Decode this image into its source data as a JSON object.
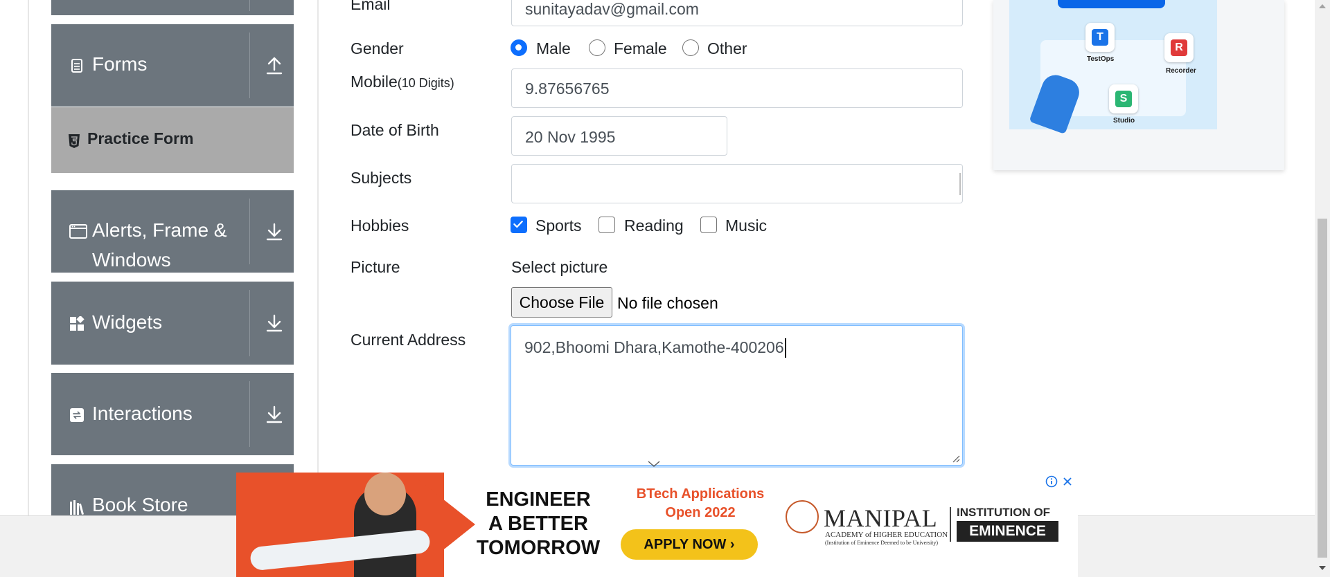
{
  "sidebar": {
    "groups": [
      {
        "label": "Forms",
        "icon": "form-icon",
        "arrow": "upload-arrow-icon"
      },
      {
        "label_lines": [
          "Alerts, Frame &",
          "Windows"
        ],
        "icon": "browser-window-icon",
        "arrow": "download-arrow-icon"
      },
      {
        "label": "Widgets",
        "icon": "widgets-icon",
        "arrow": "download-arrow-icon"
      },
      {
        "label": "Interactions",
        "icon": "interactions-icon",
        "arrow": "download-arrow-icon"
      },
      {
        "label": "Book Store",
        "icon": "books-icon"
      }
    ],
    "active_item": {
      "label": "Practice Form",
      "icon": "html5-icon"
    }
  },
  "form": {
    "email": {
      "label": "Email",
      "value": "sunitayadav@gmail.com"
    },
    "gender": {
      "label": "Gender",
      "options": [
        "Male",
        "Female",
        "Other"
      ],
      "selected": "Male"
    },
    "mobile": {
      "label": "Mobile",
      "label_hint": "(10 Digits)",
      "value": "9.87656765"
    },
    "dob": {
      "label": "Date of Birth",
      "value": "20 Nov 1995"
    },
    "subjects": {
      "label": "Subjects",
      "value": ""
    },
    "hobbies": {
      "label": "Hobbies",
      "options": [
        {
          "label": "Sports",
          "checked": true
        },
        {
          "label": "Reading",
          "checked": false
        },
        {
          "label": "Music",
          "checked": false
        }
      ]
    },
    "picture": {
      "label": "Picture",
      "prompt": "Select picture",
      "button": "Choose File",
      "status": "No file chosen"
    },
    "address": {
      "label": "Current Address",
      "value": "902,Bhoomi Dhara,Kamothe-400206"
    }
  },
  "side_ad": {
    "labels": [
      "TestOps",
      "Recorder",
      "Studio"
    ],
    "badges": [
      "T",
      "R",
      "S"
    ]
  },
  "banner_ad": {
    "headline": [
      "ENGINEER",
      "A BETTER",
      "TOMORROW"
    ],
    "sub": [
      "BTech Applications",
      "Open 2022"
    ],
    "cta": "APPLY NOW",
    "brand": "MANIPAL",
    "brand_sub": "ACADEMY of HIGHER EDUCATION",
    "brand_tag": "(Institution of Eminence Deemed to be University)",
    "institution": "INSTITUTION OF",
    "eminence": "EMINENCE"
  },
  "colors": {
    "sidebar_bg": "#6c757d",
    "active_item_bg": "#aaaaaa",
    "accent": "#0d6efd",
    "focus": "#80bdff",
    "ad_orange": "#e8512a",
    "ad_yellow": "#f3c21a"
  }
}
